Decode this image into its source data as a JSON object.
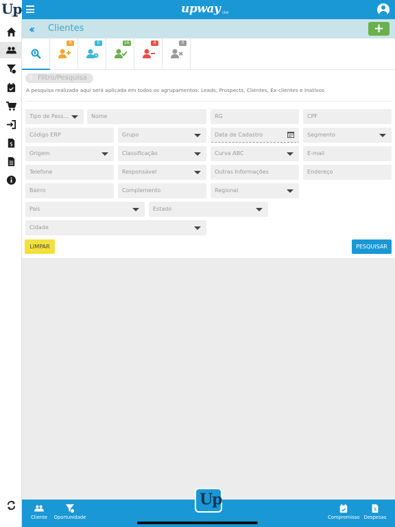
{
  "app": {
    "brand": "upway",
    "brand_suffix": "CRM",
    "logo_text": "Up",
    "logo_suffix": "CRM",
    "accent": "#1a98d5"
  },
  "header": {
    "title": "Clientes",
    "add_label": "+"
  },
  "tabs": [
    {
      "name": "search",
      "badge": "",
      "color": "#1a98d5"
    },
    {
      "name": "leads",
      "badge": "0",
      "color": "#f3a634"
    },
    {
      "name": "prospects",
      "badge": "0",
      "color": "#3bb9d8"
    },
    {
      "name": "clientes",
      "badge": "16",
      "color": "#6ab04c"
    },
    {
      "name": "ex-clientes",
      "badge": "4",
      "color": "#e5524b"
    },
    {
      "name": "inativos",
      "badge": "0",
      "color": "#999999"
    }
  ],
  "filter": {
    "pill_label": "Filtro/Pesquisa",
    "notice": "A pesquisa realizada aqui será aplicada em todos os agrupamentos: Leads, Prospects, Clientes, Ex-clientes e Inativos",
    "fields": {
      "tipo_pessoa": "Tipo de Pess...",
      "nome": "Nome",
      "rg": "RG",
      "cpf": "CPF",
      "codigo_erp": "Código ERP",
      "grupo": "Grupo",
      "data_cadastro": "Data de Cadastro",
      "segmento": "Segmento",
      "origem": "Origem",
      "classificacao": "Classificação",
      "curva_abc": "Curva ABC",
      "email": "E-mail",
      "telefone": "Telefone",
      "responsavel": "Responsável",
      "outras_info": "Outras Informações",
      "endereco": "Endereço",
      "bairro": "Bairro",
      "complemento": "Complemento",
      "regional": "Regional",
      "pais": "País",
      "estado": "Estado",
      "cidade": "Cidade"
    },
    "clear_label": "LIMPAR",
    "search_label": "PESQUISAR"
  },
  "bottom_nav": {
    "cliente": "Cliente",
    "oportunidade": "Oportunidade",
    "compromisso": "Compromisso",
    "despesas": "Despesas",
    "center_logo": "Up"
  }
}
